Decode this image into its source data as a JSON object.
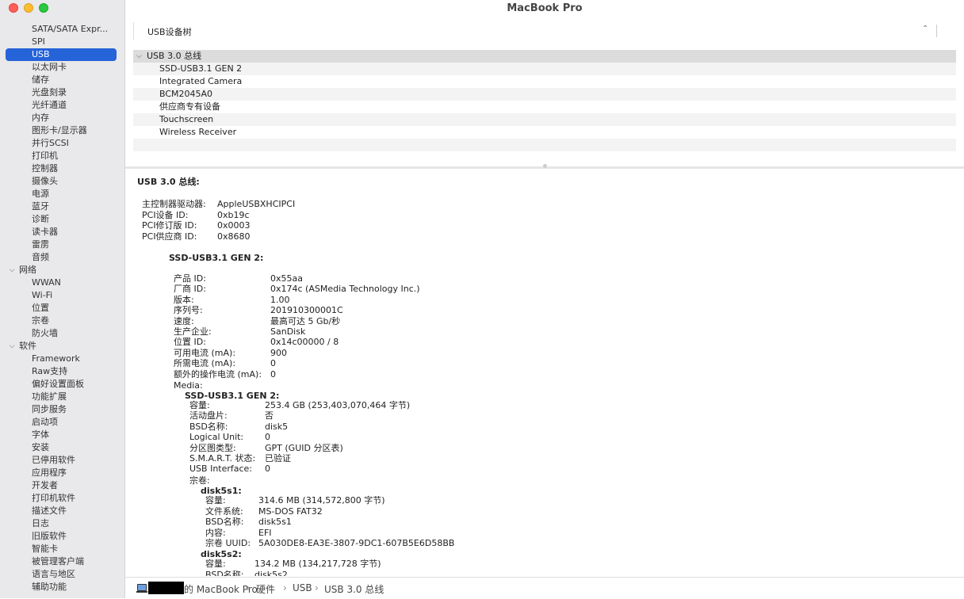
{
  "window": {
    "title": "MacBook Pro"
  },
  "sidebar": {
    "hardware_items": [
      "SATA/SATA Expr...",
      "SPI",
      "USB",
      "以太网卡",
      "储存",
      "光盘刻录",
      "光纤通道",
      "内存",
      "图形卡/显示器",
      "并行SCSI",
      "打印机",
      "控制器",
      "摄像头",
      "电源",
      "蓝牙",
      "诊断",
      "读卡器",
      "雷雳",
      "音频"
    ],
    "network_label": "网络",
    "network_items": [
      "WWAN",
      "Wi-Fi",
      "位置",
      "宗卷",
      "防火墙"
    ],
    "software_label": "软件",
    "software_items": [
      "Framework",
      "Raw支持",
      "偏好设置面板",
      "功能扩展",
      "同步服务",
      "启动项",
      "字体",
      "安装",
      "已停用软件",
      "应用程序",
      "开发者",
      "打印机软件",
      "描述文件",
      "日志",
      "旧版软件",
      "智能卡",
      "被管理客户端",
      "语言与地区",
      "辅助功能"
    ],
    "selected": "USB"
  },
  "tree": {
    "header": "USB设备树",
    "bus": "USB 3.0 总线",
    "devices": [
      "SSD-USB3.1 GEN 2",
      "Integrated Camera",
      "BCM2045A0",
      "供应商专有设备",
      "Touchscreen",
      "Wireless Receiver"
    ]
  },
  "detail": {
    "bus_title": "USB 3.0 总线:",
    "bus_fields": [
      {
        "k": "主控制器驱动器:",
        "v": "AppleUSBXHCIPCI"
      },
      {
        "k": "PCI设备 ID:",
        "v": "0xb19c"
      },
      {
        "k": "PCI修订版 ID:",
        "v": "0x0003"
      },
      {
        "k": "PCI供应商 ID:",
        "v": "0x8680"
      }
    ],
    "device_title": "SSD-USB3.1 GEN 2:",
    "device_fields": [
      {
        "k": "产品 ID:",
        "v": "0x55aa"
      },
      {
        "k": "厂商 ID:",
        "v": "0x174c  (ASMedia Technology Inc.)"
      },
      {
        "k": "版本:",
        "v": "1.00"
      },
      {
        "k": "序列号:",
        "v": "201910300001C"
      },
      {
        "k": "速度:",
        "v": "最高可达 5 Gb/秒"
      },
      {
        "k": "生产企业:",
        "v": "SanDisk"
      },
      {
        "k": "位置 ID:",
        "v": "0x14c00000 / 8"
      },
      {
        "k": "可用电流 (mA):",
        "v": "900"
      },
      {
        "k": "所需电流 (mA):",
        "v": "0"
      },
      {
        "k": "额外的操作电流 (mA):",
        "v": "0"
      }
    ],
    "media_label": "Media:",
    "media_title": "SSD-USB3.1 GEN 2:",
    "media_fields": [
      {
        "k": "容量:",
        "v": "253.4 GB (253,403,070,464 字节)"
      },
      {
        "k": "活动盘片:",
        "v": "否"
      },
      {
        "k": "BSD名称:",
        "v": "disk5"
      },
      {
        "k": "Logical Unit:",
        "v": "0"
      },
      {
        "k": "分区图类型:",
        "v": "GPT (GUID 分区表)"
      },
      {
        "k": "S.M.A.R.T. 状态:",
        "v": "已验证"
      },
      {
        "k": "USB Interface:",
        "v": "0"
      }
    ],
    "volumes_label": "宗卷:",
    "vol1_title": "disk5s1:",
    "vol1_fields": [
      {
        "k": "容量:",
        "v": "314.6 MB (314,572,800 字节)"
      },
      {
        "k": "文件系统:",
        "v": "MS-DOS FAT32"
      },
      {
        "k": "BSD名称:",
        "v": "disk5s1"
      },
      {
        "k": "内容:",
        "v": "EFI"
      },
      {
        "k": "宗卷 UUID:",
        "v": "5A030DE8-EA3E-3807-9DC1-607B5E6D58BB"
      }
    ],
    "vol2_title": "disk5s2:",
    "vol2_fields": [
      {
        "k": "容量:",
        "v": "134.2 MB (134,217,728 字节)"
      },
      {
        "k": "BSD名称:",
        "v": "disk5s2"
      }
    ]
  },
  "pathbar": {
    "owner_suffix": "的 MacBook Pro",
    "crumbs": [
      "硬件",
      "USB",
      "USB 3.0 总线"
    ],
    "separator": "›"
  }
}
